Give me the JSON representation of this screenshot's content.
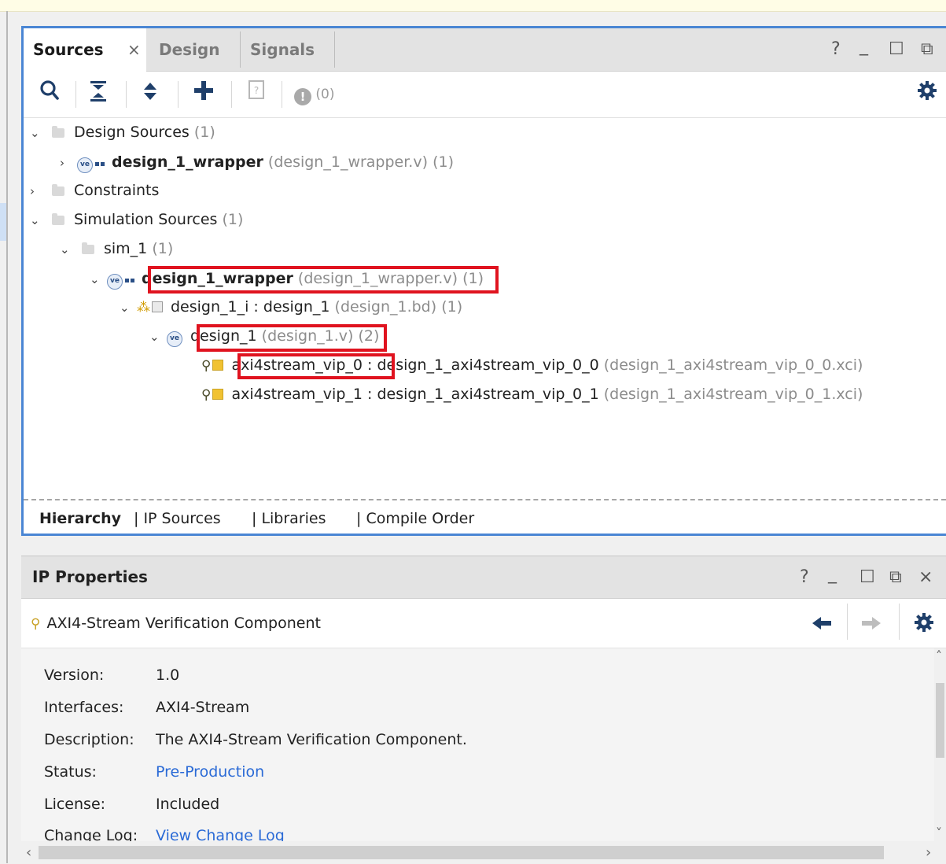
{
  "sources_panel": {
    "tabs": [
      {
        "label": "Sources",
        "active": true
      },
      {
        "label": "Design",
        "active": false
      },
      {
        "label": "Signals",
        "active": false
      }
    ],
    "tab_close": "×",
    "window_controls": [
      "?",
      "_",
      "☐",
      "⧉"
    ],
    "toolbar": {
      "issues_count": "(0)"
    },
    "tree": [
      {
        "id": "design-sources",
        "label": "Design Sources",
        "suffix": "(1)"
      },
      {
        "id": "wrapper-design",
        "name": "design_1_wrapper",
        "file": "(design_1_wrapper.v)",
        "count": "(1)"
      },
      {
        "id": "constraints",
        "label": "Constraints"
      },
      {
        "id": "simulation-sources",
        "label": "Simulation Sources",
        "suffix": "(1)"
      },
      {
        "id": "sim-1",
        "label": "sim_1",
        "suffix": "(1)"
      },
      {
        "id": "wrapper-sim",
        "name": "design_1_wrapper",
        "file": "(design_1_wrapper.v)",
        "count": "(1)"
      },
      {
        "id": "design-1-i",
        "name": "design_1_i : design_1",
        "file": "(design_1.bd)",
        "count": "(1)"
      },
      {
        "id": "design-1",
        "name": "design_1",
        "file": "(design_1.v)",
        "count": "(2)"
      },
      {
        "id": "vip-0",
        "name": "axi4stream_vip_0",
        "sep": " : ",
        "module": "design_1_axi4stream_vip_0_0",
        "file": "(design_1_axi4stream_vip_0_0.xci)"
      },
      {
        "id": "vip-1",
        "name": "axi4stream_vip_1",
        "sep": " : ",
        "module": "design_1_axi4stream_vip_0_1",
        "file": "(design_1_axi4stream_vip_0_1.xci)"
      }
    ],
    "bottom_tabs": [
      "Hierarchy",
      "| IP Sources",
      "| Libraries",
      "| Compile Order"
    ]
  },
  "ip_properties": {
    "title": "IP Properties",
    "window_controls": [
      "?",
      "_",
      "☐",
      "⧉",
      "×"
    ],
    "component_name": "AXI4-Stream Verification Component",
    "properties": [
      {
        "label": "Version:",
        "value": "1.0"
      },
      {
        "label": "Interfaces:",
        "value": "AXI4-Stream"
      },
      {
        "label": "Description:",
        "value": "The AXI4-Stream Verification Component."
      },
      {
        "label": "Status:",
        "value": "Pre-Production"
      },
      {
        "label": "License:",
        "value": "Included"
      },
      {
        "label": "Change Log:",
        "value": "View Change Log"
      }
    ]
  },
  "colors": {
    "panel_border": "#4a86d4",
    "highlight": "#e0131f",
    "link": "#2a6ad6"
  }
}
